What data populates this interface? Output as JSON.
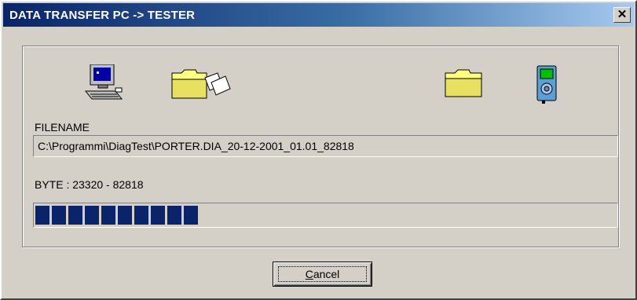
{
  "window": {
    "title": "DATA TRANSFER PC -> TESTER"
  },
  "icons": [
    "computer-icon",
    "folder-sending-icon",
    "folder-icon",
    "tester-device-icon"
  ],
  "file": {
    "label": "FILENAME",
    "value": "C:\\Programmi\\DiagTest\\PORTER.DIA_20-12-2001_01.01_82818"
  },
  "byte": {
    "label": "BYTE : 23320 - 82818",
    "transferred": 23320,
    "total": 82818
  },
  "progress": {
    "fraction": 0.2816,
    "color": "#0a246a"
  },
  "buttons": {
    "cancel": "Cancel",
    "cancel_accelerator": "C",
    "cancel_rest": "ancel"
  }
}
